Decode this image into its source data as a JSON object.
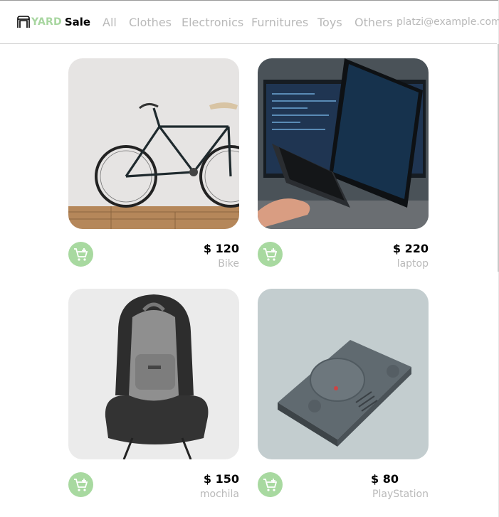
{
  "brand": {
    "yard": "YARD",
    "sale": "Sale"
  },
  "nav": {
    "items": [
      "All",
      "Clothes",
      "Electronics",
      "Furnitures",
      "Toys",
      "Others"
    ],
    "email": "platzi@example.com"
  },
  "products": [
    {
      "price": "$ 120",
      "name": "Bike"
    },
    {
      "price": "$ 220",
      "name": "laptop"
    },
    {
      "price": "$ 150",
      "name": "mochila"
    },
    {
      "price": "$ 80",
      "name": "PlayStation"
    }
  ],
  "colors": {
    "accent": "#a8d9a0",
    "muted": "#b9b9b9"
  }
}
